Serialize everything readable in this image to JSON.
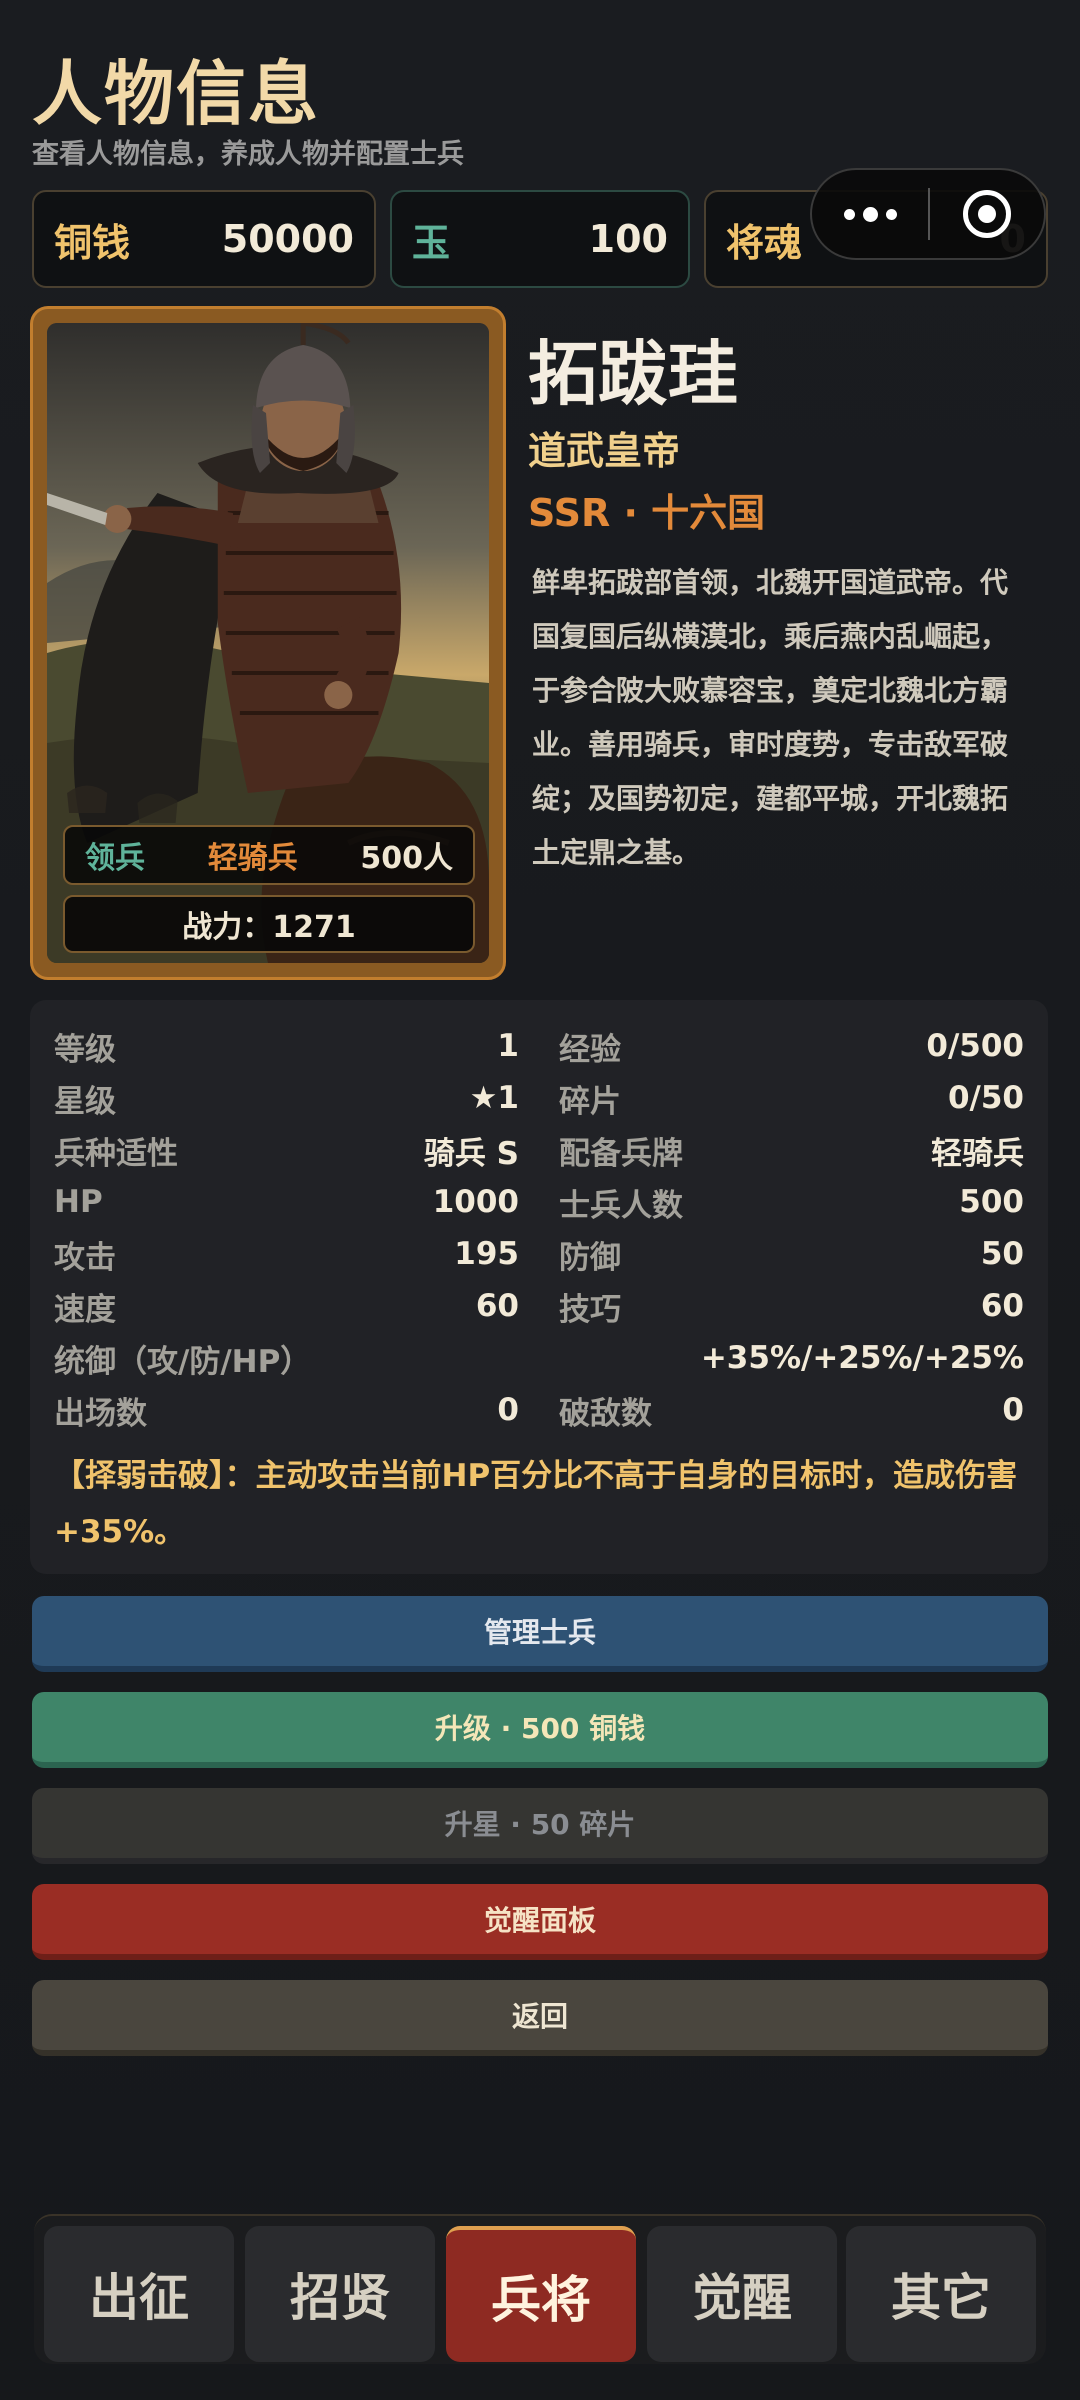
{
  "header": {
    "title": "人物信息",
    "subtitle": "查看人物信息，养成人物并配置士兵"
  },
  "currency": [
    {
      "label": "铜钱",
      "value": "50000"
    },
    {
      "label": "玉",
      "value": "100"
    },
    {
      "label": "将魂",
      "value": "0"
    }
  ],
  "hero": {
    "name": "拓跋珪",
    "title": "道武皇帝",
    "rank": "SSR · 十六国",
    "description": "鲜卑拓跋部首领，北魏开国道武帝。代国复国后纵横漠北，乘后燕内乱崛起，于参合陂大败慕容宝，奠定北魏北方霸业。善用骑兵，审时度势，专击敌军破绽；及国势初定，建都平城，开北魏拓土定鼎之基。",
    "troop_label": "领兵",
    "troop_type": "轻骑兵",
    "troop_count": "500人",
    "power": "战力：1271"
  },
  "stats": {
    "rows": [
      {
        "k": "等级",
        "v": "1"
      },
      {
        "k": "经验",
        "v": "0/500"
      },
      {
        "k": "星级",
        "v": "★1"
      },
      {
        "k": "碎片",
        "v": "0/50"
      },
      {
        "k": "兵种适性",
        "v": "骑兵 S"
      },
      {
        "k": "配备兵牌",
        "v": "轻骑兵"
      },
      {
        "k": "HP",
        "v": "1000"
      },
      {
        "k": "士兵人数",
        "v": "500"
      },
      {
        "k": "攻击",
        "v": "195"
      },
      {
        "k": "防御",
        "v": "50"
      },
      {
        "k": "速度",
        "v": "60"
      },
      {
        "k": "技巧",
        "v": "60"
      }
    ],
    "command": {
      "k": "统御（攻/防/HP）",
      "v": "+35%/+25%/+25%"
    },
    "battles": {
      "k": "出场数",
      "v": "0"
    },
    "kills": {
      "k": "破敌数",
      "v": "0"
    },
    "skill": "【择弱击破】：主动攻击当前HP百分比不高于自身的目标时，造成伤害+35%。"
  },
  "buttons": {
    "manage": "管理士兵",
    "upgrade": "升级 · 500 铜钱",
    "star": "升星 · 50 碎片",
    "awaken": "觉醒面板",
    "back": "返回"
  },
  "nav": [
    "出征",
    "招贤",
    "兵将",
    "觉醒",
    "其它"
  ],
  "nav_active": "兵将"
}
